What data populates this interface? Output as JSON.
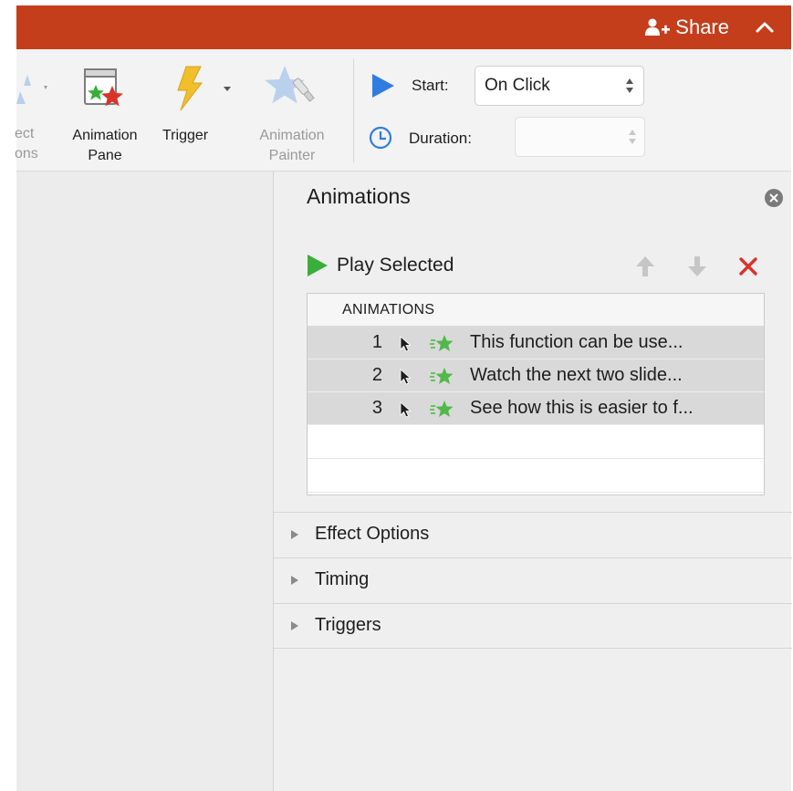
{
  "titlebar": {
    "share_label": "Share",
    "accent_color": "#c43e1c"
  },
  "ribbon": {
    "effect_options_partial": [
      "ect",
      "ons"
    ],
    "animation_pane": [
      "Animation",
      "Pane"
    ],
    "trigger": "Trigger",
    "animation_painter": [
      "Animation",
      "Painter"
    ],
    "start_label": "Start:",
    "start_value": "On Click",
    "duration_label": "Duration:",
    "duration_value": ""
  },
  "pane": {
    "title": "Animations",
    "play_selected": "Play Selected",
    "list_header": "ANIMATIONS",
    "items": [
      {
        "num": "1",
        "text": "This function can be use..."
      },
      {
        "num": "2",
        "text": "Watch the next two slide..."
      },
      {
        "num": "3",
        "text": "See how this is easier to f..."
      }
    ],
    "sections": [
      "Effect Options",
      "Timing",
      "Triggers"
    ]
  },
  "colors": {
    "play_green": "#3aae3a",
    "star_green": "#52b84a",
    "remove_red": "#d9332a",
    "start_blue": "#2f7de1"
  }
}
